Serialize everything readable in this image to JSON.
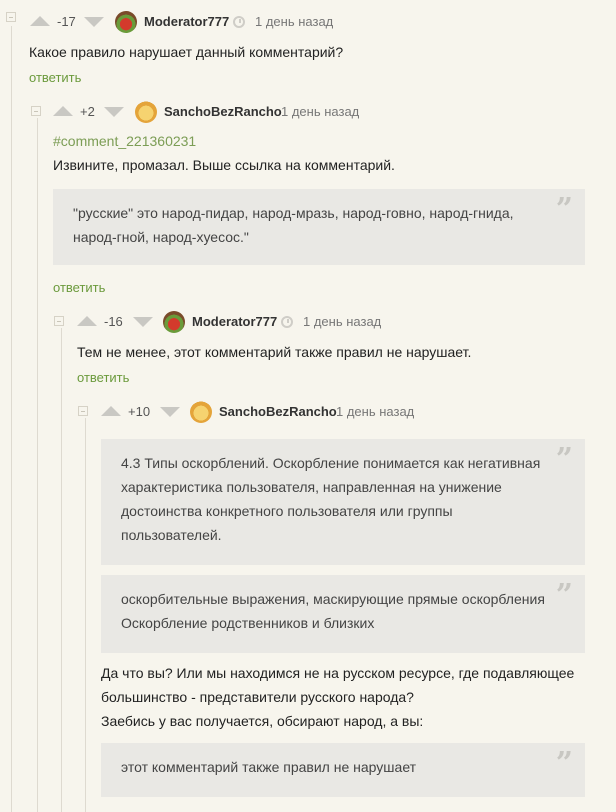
{
  "colors": {
    "background": "#f7f5ed",
    "accent": "#6b9a3c",
    "quote_bg": "#e9e8e4"
  },
  "c1": {
    "rating": "-17",
    "author": "Moderator777",
    "time": "1 день назад",
    "text": "Какое правило нарушает данный комментарий?",
    "reply": "ответить"
  },
  "c2": {
    "rating": "+2",
    "author": "SanchoBezRancho",
    "time": "1 день назад",
    "link": "#comment_221360231",
    "text": "Извините, промазал. Выше ссылка на комментарий.",
    "quote": "\"русские\" это народ-пидар, народ-мразь, народ-говно, народ-гнида, народ-гной, народ-хуесос.\"",
    "reply": "ответить"
  },
  "c3": {
    "rating": "-16",
    "author": "Moderator777",
    "time": "1 день назад",
    "text": "Тем не менее, этот комментарий также правил не нарушает.",
    "reply": "ответить"
  },
  "c4": {
    "rating": "+10",
    "author": "SanchoBezRancho",
    "time": "1 день назад",
    "quote1": "4.3 Типы оскорблений. Оскорбление понимается как негативная характеристика пользователя, направленная на унижение достоинства конкретного пользователя или группы пользователей.",
    "quote2": "оскорбительные выражения, маскирующие прямые оскорбления Оскорбление родственников и близких",
    "text_line1": "Да что вы? Или мы находимся не на русском ресурсе, где подавляющее большинство - представители русского народа?",
    "text_line2": "Заебись у вас получается, обсирают народ, а вы:",
    "quote3": "этот комментарий также правил не нарушает"
  }
}
